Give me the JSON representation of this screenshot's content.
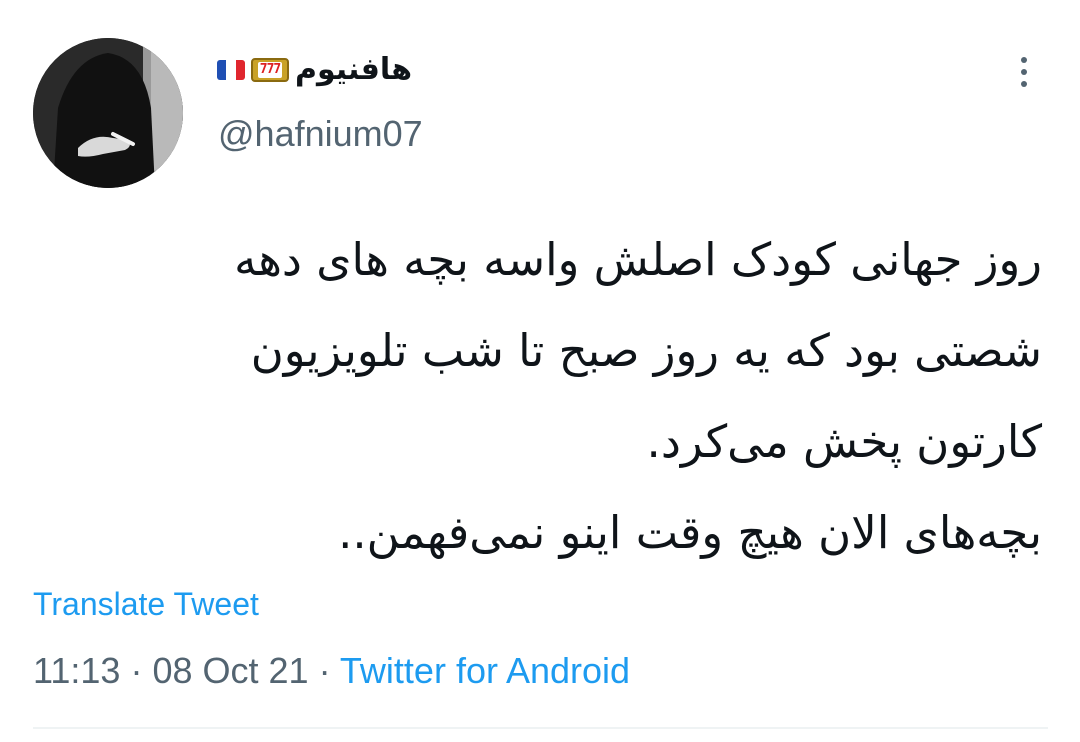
{
  "tweet": {
    "author": {
      "display_name": "هافنیوم",
      "emojis": [
        "flag-france",
        "slot-machine-777"
      ],
      "slot_text": "777",
      "handle": "@hafnium07",
      "avatar": "avatar-photo"
    },
    "more_icon": "more-vertical-icon",
    "text_lines": [
      "روز جهانی کودک اصلش واسه بچه های دهه",
      "شصتی بود که یه روز صبح تا شب تلویزیون",
      "کارتون پخش می‌کرد.",
      "بچه‌های الان هیچ وقت اینو نمی‌فهمن.."
    ],
    "translate_label": "Translate Tweet",
    "time": "11:13",
    "separator": "·",
    "date": "08 Oct 21",
    "source": "Twitter for Android"
  },
  "colors": {
    "text_primary": "#0f1419",
    "text_secondary": "#536471",
    "link": "#1d9bf0",
    "divider": "#eff3f4"
  }
}
